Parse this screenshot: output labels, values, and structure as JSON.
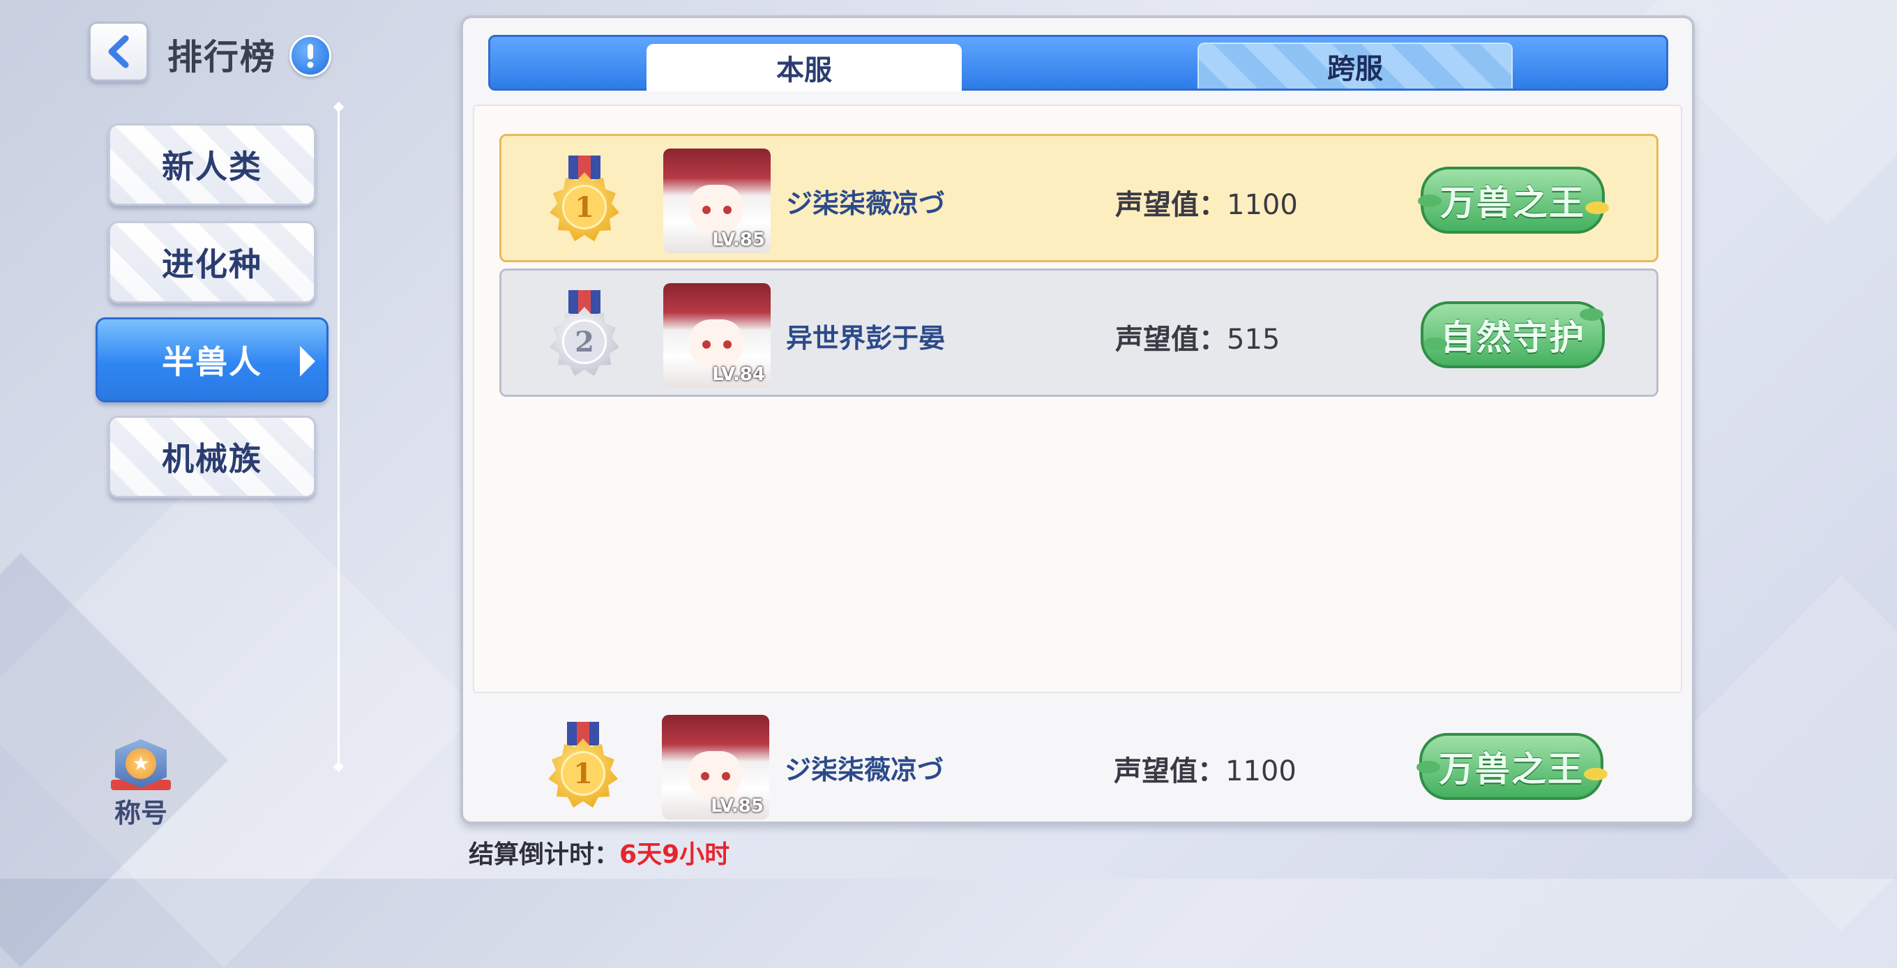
{
  "header": {
    "title": "排行榜"
  },
  "categories": [
    {
      "label": "新人类"
    },
    {
      "label": "进化种"
    },
    {
      "label": "半兽人"
    },
    {
      "label": "机械族"
    }
  ],
  "side": {
    "title_label": "称号"
  },
  "tabs": [
    {
      "label": "本服"
    },
    {
      "label": "跨服"
    }
  ],
  "rankings": [
    {
      "rank": "1",
      "level": "LV.85",
      "name": "ジ柒柒薇凉づ",
      "prestige_label": "声望值：",
      "prestige_value": "1100",
      "title_art": "万兽之王"
    },
    {
      "rank": "2",
      "level": "LV.84",
      "name": "异世界彭于晏",
      "prestige_label": "声望值：",
      "prestige_value": "515",
      "title_art": "自然守护"
    }
  ],
  "self_rank": {
    "rank": "1",
    "level": "LV.85",
    "name": "ジ柒柒薇凉づ",
    "prestige_label": "声望值：",
    "prestige_value": "1100",
    "title_art": "万兽之王"
  },
  "footer": {
    "countdown_label": "结算倒计时：",
    "countdown_value": "6天9小时"
  }
}
